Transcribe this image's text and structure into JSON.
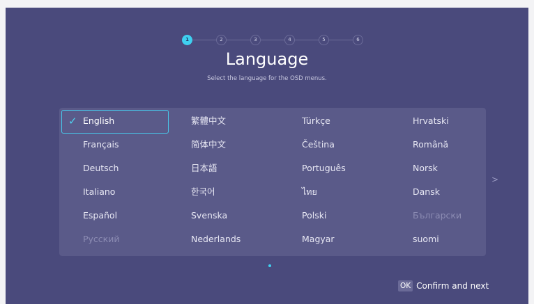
{
  "stepper": {
    "steps": [
      "1",
      "2",
      "3",
      "4",
      "5",
      "6"
    ],
    "active_step": "1"
  },
  "header": {
    "title": "Language",
    "subtitle": "Select the language for the OSD menus."
  },
  "languages": {
    "selected": "English",
    "grid": [
      [
        "English",
        "繁體中文",
        "Türkçe",
        "Hrvatski"
      ],
      [
        "Français",
        "简体中文",
        "Čeština",
        "Română"
      ],
      [
        "Deutsch",
        "日本語",
        "Português",
        "Norsk"
      ],
      [
        "Italiano",
        "한국어",
        "ไทย",
        "Dansk"
      ],
      [
        "Español",
        "Svenska",
        "Polski",
        "Български"
      ],
      [
        "Русский",
        "Nederlands",
        "Magyar",
        "suomi"
      ]
    ],
    "dimmed": [
      "Русский",
      "Български"
    ]
  },
  "pagination": {
    "next_icon": "chevron-right-icon",
    "current_page": 1
  },
  "footer": {
    "ok_key": "OK",
    "confirm_label": "Confirm and next"
  },
  "colors": {
    "background": "#4a4a7c",
    "panel": "#5a5a89",
    "accent": "#3fd0f0"
  }
}
